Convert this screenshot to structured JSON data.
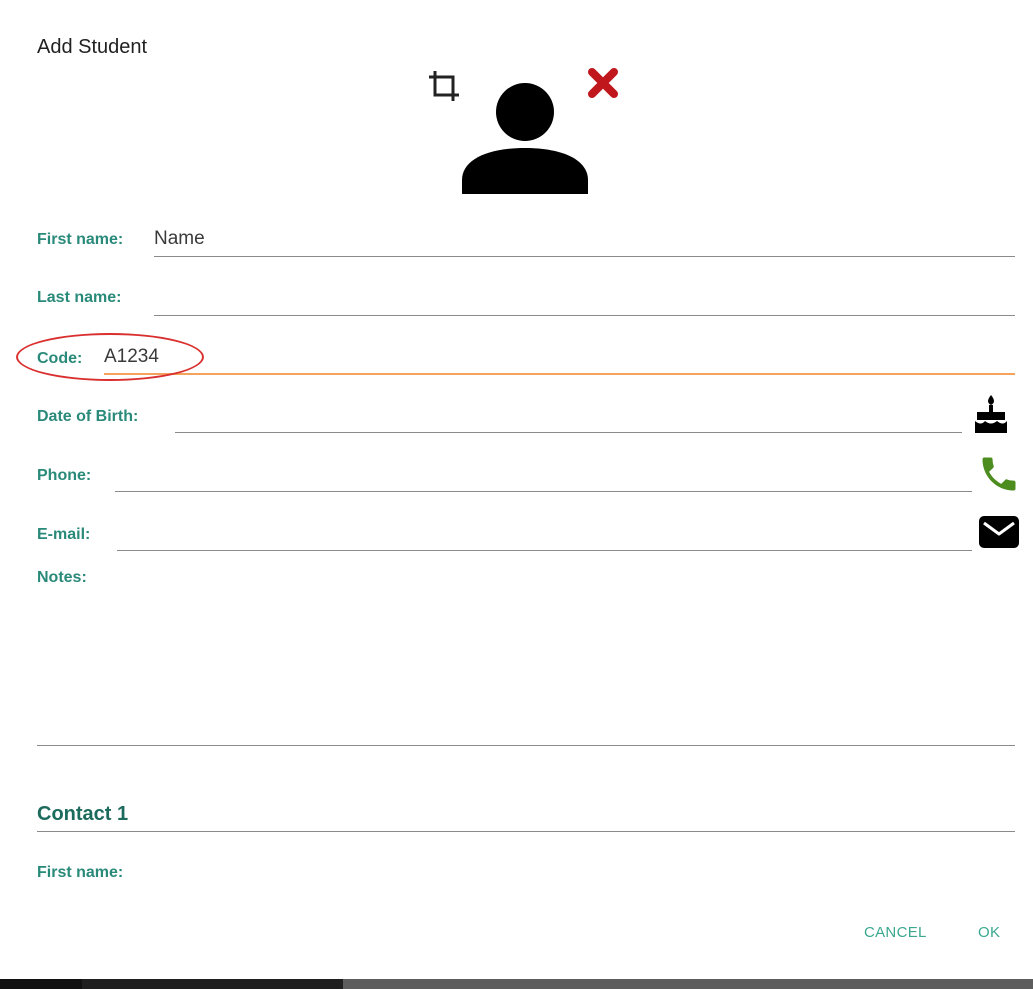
{
  "dialog": {
    "title": "Add Student"
  },
  "photo": {
    "crop_icon": "crop-icon",
    "avatar_icon": "person-icon",
    "remove_icon": "close-icon",
    "remove_color": "#c0171d"
  },
  "form": {
    "first_name": {
      "label": "First name:",
      "value": "Name"
    },
    "last_name": {
      "label": "Last name:",
      "value": ""
    },
    "code": {
      "label": "Code:",
      "value": "A1234"
    },
    "dob": {
      "label": "Date of Birth:",
      "value": "",
      "icon": "cake-icon"
    },
    "phone": {
      "label": "Phone:",
      "value": "",
      "icon": "phone-icon"
    },
    "email": {
      "label": "E-mail:",
      "value": "",
      "icon": "mail-icon"
    },
    "notes": {
      "label": "Notes:",
      "value": ""
    }
  },
  "contact1": {
    "title": "Contact 1",
    "first_name": {
      "label": "First name:"
    }
  },
  "actions": {
    "cancel": "CANCEL",
    "ok": "OK"
  },
  "colors": {
    "label": "#2a8a7a",
    "accent": "#3aa78f",
    "focus_underline": "#f5a25d",
    "highlight_ring": "#d9302f"
  }
}
